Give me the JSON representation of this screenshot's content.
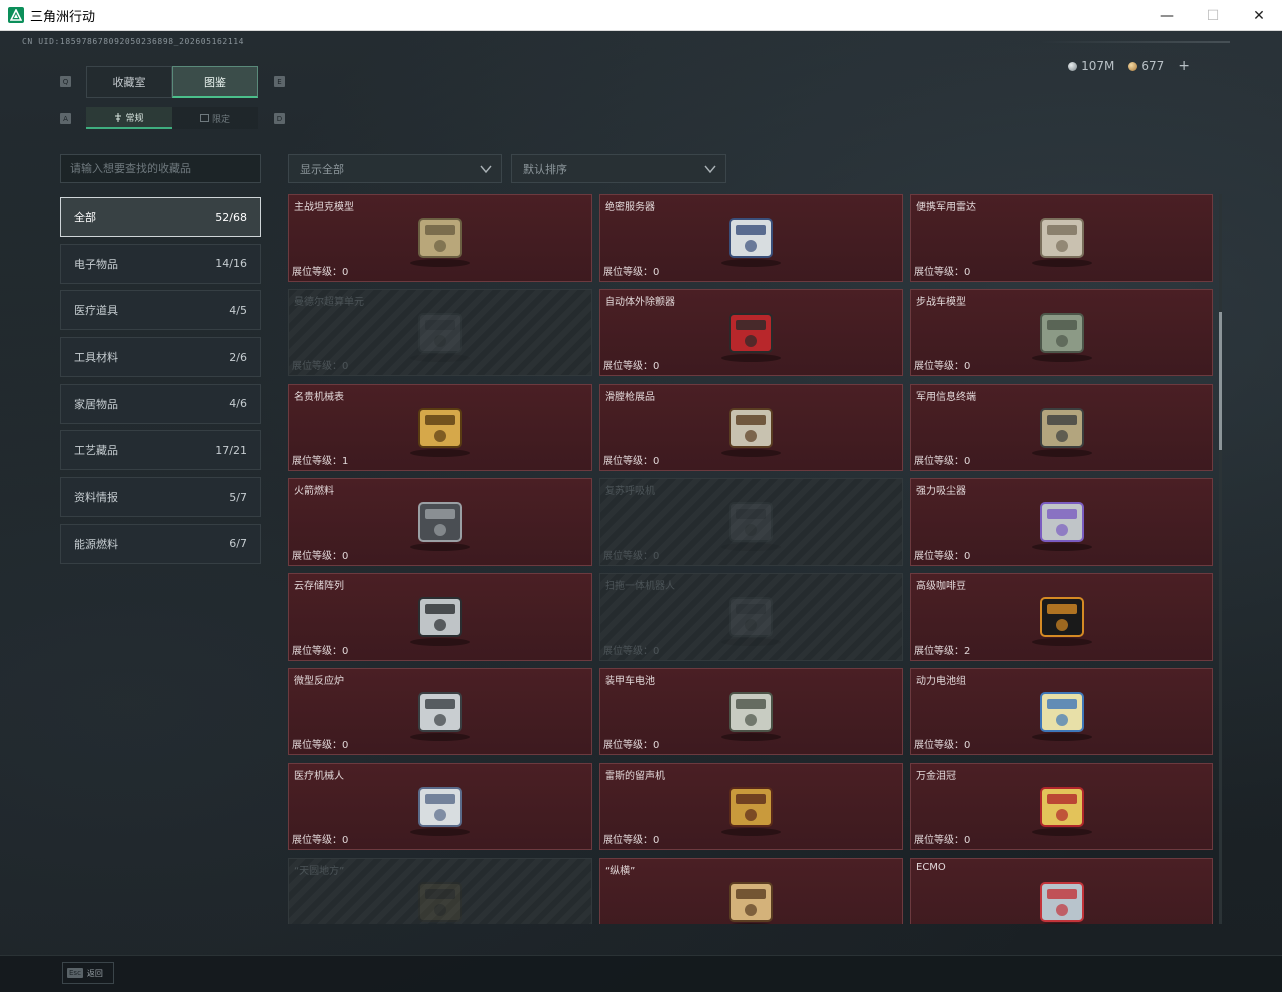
{
  "window": {
    "title": "三角洲行动",
    "minimize": "—",
    "maximize": "☐",
    "close": "✕"
  },
  "uid": "CN UID:1859786780920502368​98_202605162114",
  "currency": {
    "silver": "107M",
    "gold": "677",
    "add": "+"
  },
  "tabs": {
    "prev_key": "Q",
    "next_key": "E",
    "main": [
      "收藏室",
      "图鉴"
    ],
    "active_main": 1,
    "sub_prev_key": "A",
    "sub_next_key": "D",
    "sub": [
      "常规",
      "限定"
    ],
    "active_sub": 0
  },
  "search": {
    "placeholder": "请输入想要查找的收藏品"
  },
  "categories": [
    {
      "label": "全部",
      "count": "52/68",
      "active": true
    },
    {
      "label": "电子物品",
      "count": "14/16"
    },
    {
      "label": "医疗道具",
      "count": "4/5"
    },
    {
      "label": "工具材料",
      "count": "2/6"
    },
    {
      "label": "家居物品",
      "count": "4/6"
    },
    {
      "label": "工艺藏品",
      "count": "17/21"
    },
    {
      "label": "资料情报",
      "count": "5/7"
    },
    {
      "label": "能源燃料",
      "count": "6/7"
    }
  ],
  "filters": {
    "display": "显示全部",
    "sort": "默认排序"
  },
  "level_prefix": "展位等级：",
  "items": [
    {
      "name": "主战坦克模型",
      "level": "0",
      "locked": false,
      "icon": "tank-model-icon"
    },
    {
      "name": "绝密服务器",
      "level": "0",
      "locked": false,
      "icon": "server-icon"
    },
    {
      "name": "便携军用雷达",
      "level": "0",
      "locked": false,
      "icon": "radar-icon"
    },
    {
      "name": "曼德尔超算单元",
      "level": "0",
      "locked": true,
      "icon": "supercomputer-icon"
    },
    {
      "name": "自动体外除颤器",
      "level": "0",
      "locked": false,
      "icon": "defibrillator-icon"
    },
    {
      "name": "步战车模型",
      "level": "0",
      "locked": false,
      "icon": "ifv-model-icon"
    },
    {
      "name": "名贵机械表",
      "level": "1",
      "locked": false,
      "icon": "watch-icon"
    },
    {
      "name": "滑膛枪展品",
      "level": "0",
      "locked": false,
      "icon": "musket-icon"
    },
    {
      "name": "军用信息终端",
      "level": "0",
      "locked": false,
      "icon": "terminal-icon"
    },
    {
      "name": "火箭燃料",
      "level": "0",
      "locked": false,
      "icon": "fuel-can-icon"
    },
    {
      "name": "复苏呼吸机",
      "level": "0",
      "locked": true,
      "icon": "ventilator-icon"
    },
    {
      "name": "强力吸尘器",
      "level": "0",
      "locked": false,
      "icon": "vacuum-icon"
    },
    {
      "name": "云存储阵列",
      "level": "0",
      "locked": false,
      "icon": "storage-array-icon"
    },
    {
      "name": "扫拖一体机器人",
      "level": "0",
      "locked": true,
      "icon": "robot-vacuum-icon"
    },
    {
      "name": "高级咖啡豆",
      "level": "2",
      "locked": false,
      "icon": "coffee-bag-icon"
    },
    {
      "name": "微型反应炉",
      "level": "0",
      "locked": false,
      "icon": "reactor-icon"
    },
    {
      "name": "装甲车电池",
      "level": "0",
      "locked": false,
      "icon": "battery-icon"
    },
    {
      "name": "动力电池组",
      "level": "0",
      "locked": false,
      "icon": "battery-pack-icon"
    },
    {
      "name": "医疗机械人",
      "level": "0",
      "locked": false,
      "icon": "medical-robot-icon"
    },
    {
      "name": "雷斯的留声机",
      "level": "0",
      "locked": false,
      "icon": "gramophone-icon"
    },
    {
      "name": "万金泪冠",
      "level": "0",
      "locked": false,
      "icon": "crown-egg-icon"
    },
    {
      "name": "“天圆地方”",
      "level": "",
      "locked": true,
      "icon": "coin-icon"
    },
    {
      "name": "“纵横”",
      "level": "",
      "locked": false,
      "icon": "chessboard-icon"
    },
    {
      "name": "ECMO",
      "level": "",
      "locked": false,
      "icon": "ecmo-icon"
    }
  ],
  "footer": {
    "esc_key": "Esc",
    "back_label": "返回"
  }
}
